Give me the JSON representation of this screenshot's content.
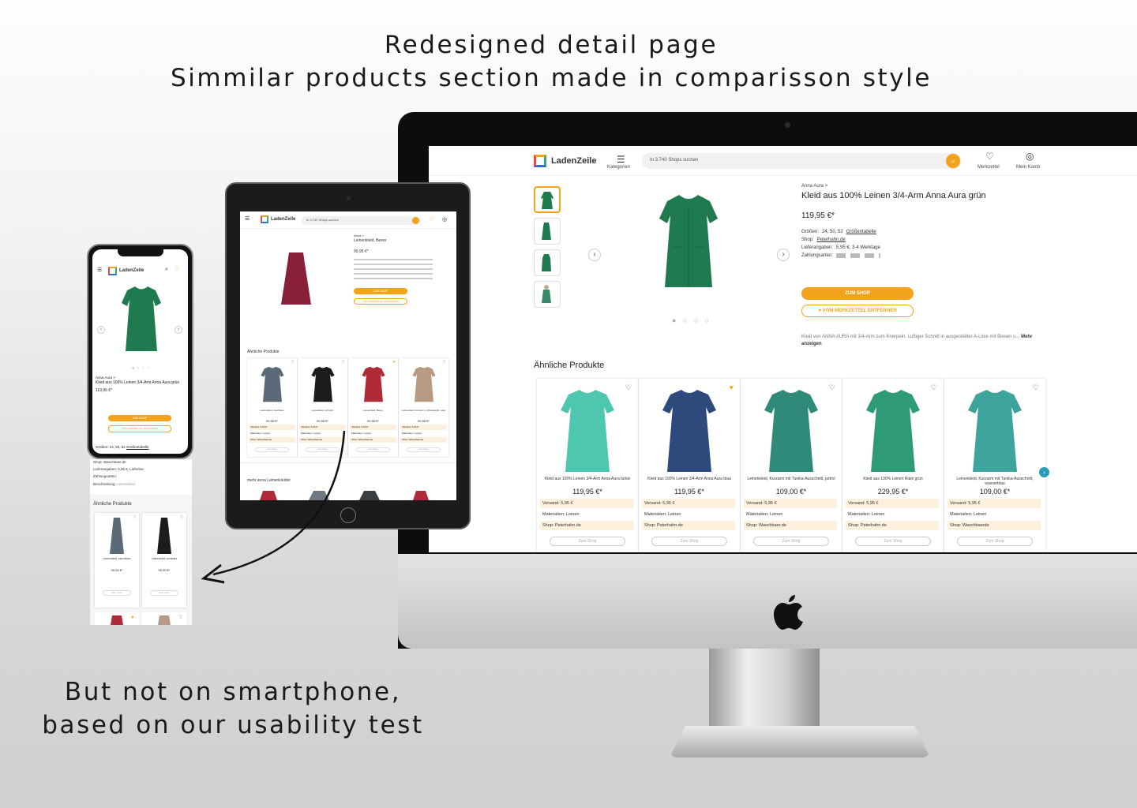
{
  "headline": {
    "line1": "Redesigned detail page",
    "line2": "Simmilar products section made in comparisson style"
  },
  "footnote": {
    "line1": "But not on smartphone,",
    "line2": "based on our usability test"
  },
  "colors": {
    "accent": "#f2a31b",
    "teal_nav": "#2a9bb8",
    "attr_bg": "#fdf0dc",
    "dress_green": "#1f7a4f"
  },
  "desktop": {
    "header": {
      "logo": "LadenZeile",
      "menu_label": "Kategorien",
      "search_placeholder": "In 3.740 Shops suchen",
      "merkzettel": "Merkzettel",
      "account": "Mein Konto"
    },
    "product": {
      "breadcrumb": "Anna Aura >",
      "title": "Kleid aus 100% Leinen 3/4-Arm Anna Aura grün",
      "price": "119,95 €*",
      "sizes_label": "Größen:",
      "sizes": "24, 50, 52",
      "size_table_link": "Größentabelle",
      "shop_label": "Shop:",
      "shop": "Peterhahn.de",
      "delivery_label": "Lieferangaben:",
      "delivery": "5,95 €, 3-4 Werktage",
      "payment_label": "Zahlungsarten:",
      "cta": "ZUM SHOP",
      "cta_remove": "VOM MERKZETTEL ENTFERNEN",
      "description": "Kleid von ANNA AURA mit 3/4-Arm zum Knerpeln. Luftiger Schnitt in ausgestellter A-Linie mit Biesen u...",
      "more_link": "Mehr anzeigen",
      "carousel_dots": "● ○ ○ ○"
    },
    "similar_title": "Ähnliche Produkte",
    "cards": [
      {
        "name": "Kleid aus 100% Leinen 3/4-Arm Anna Aura türkis",
        "price": "119,95 €*",
        "versand": "Versand: 5,95 €",
        "material": "Materialien: Leinen",
        "shop": "Shop: Peterhahn.de",
        "button": "Zum Shop",
        "color": "#4fc7b0",
        "fav": false
      },
      {
        "name": "Kleid aus 100% Leinen 3/4-Arm Anna Aura blau",
        "price": "119,95 €*",
        "versand": "Versand: 5,95 €",
        "material": "Materialien: Leinen",
        "shop": "Shop: Peterhahn.de",
        "button": "Zum Shop",
        "color": "#2e4a7d",
        "fav": true
      },
      {
        "name": "Leinenkleid, Kurzarm mit Tunika-Ausschnitt, petrol",
        "price": "109,00 €*",
        "versand": "Versand: 5,95 €",
        "material": "Materialien: Leinen",
        "shop": "Shop: Waschbaer.de",
        "button": "Zum Shop",
        "color": "#2f8a7a",
        "fav": false
      },
      {
        "name": "Kleid aus 100% Leinen Riani grün",
        "price": "229,95 €*",
        "versand": "Versand: 5,95 €",
        "material": "Materialien: Leinen",
        "shop": "Shop: Peterhahn.de",
        "button": "Zum Shop",
        "color": "#2f9a78",
        "fav": false
      },
      {
        "name": "Leinenkleid, Kurzarm mit Tunika-Ausschnitt, wasserblau",
        "price": "109,00 €*",
        "versand": "Versand: 5,95 €",
        "material": "Materialien: Leinen",
        "shop": "Shop: Waschbaerde",
        "button": "Zum Shop",
        "color": "#3ea39a",
        "fav": false
      }
    ]
  },
  "tablet": {
    "logo": "LadenZeile",
    "search_placeholder": "In 3.740 Shops suchen",
    "breadcrumb": "Anna >",
    "title": "Leinenkleid, Beere",
    "price": "99,95 €*",
    "cta": "ZUM SHOP",
    "cta_remove": "VOM MERKZETTEL ENTFERNEN",
    "similar_title": "Ähnliche Produkte",
    "more_title": "mehr anna Leinenkleider",
    "cards": [
      {
        "name": "Leinenkleid, rauchblau",
        "price": "99,95 €*",
        "versand": "Versand: 5,95 €",
        "material": "Materialien: Leinen",
        "shop": "Shop: Waschbaerde",
        "button": "Zum Shop",
        "color": "#5a6a78"
      },
      {
        "name": "Leinenkleid, schwarz",
        "price": "99,95 €*",
        "versand": "Versand: 5,95 €",
        "material": "Materialien: Leinen",
        "shop": "Shop: Waschbaerde",
        "button": "Zum Shop",
        "color": "#1c1c1c"
      },
      {
        "name": "Leinenkleid, Beere",
        "price": "99,95 €*",
        "versand": "Versand: 5,95 €",
        "material": "Materialien: Leinen",
        "shop": "Shop: Waschbaerde",
        "button": "Zum Shop",
        "color": "#b02a3a"
      },
      {
        "name": "Leinenkleid, Kurzarm in Wickeloptik, natur",
        "price": "99,95 €*",
        "versand": "Versand: 5,95 €",
        "material": "Materialien: Leinen",
        "shop": "Shop: Waschbaerde",
        "button": "Zum Shop",
        "color": "#b79a84"
      }
    ]
  },
  "phone": {
    "logo": "LadenZeile",
    "breadcrumb": "Anna Aura >",
    "title": "Kleid aus 100% Leinen 3/4-Arm Anna Aura grün",
    "price": "119,95 €*",
    "cta": "ZUM SHOP",
    "cta_remove": "VOM MERKZETTEL ENTFERNEN",
    "sizes": "Größen: 24, 50, 52",
    "size_link": "Größentabelle",
    "shop": "Shop: Waschbaer.de",
    "delivery": "Lieferangaben: 5,95 €, Lieferbar",
    "payment": "Zahlungsarten:",
    "description_label": "Beschreibung:",
    "description_value": "Leinenkleid",
    "similar_title": "Ähnliche Produkte",
    "cards": [
      {
        "name": "Leinenkleid, rauchblau",
        "price": "99,95 €*",
        "button": "Zum Shop",
        "color": "#5a6a78"
      },
      {
        "name": "Leinenkleid, schwarz",
        "price": "99,95 €*",
        "button": "Zum Shop",
        "color": "#1c1c1c"
      }
    ]
  }
}
